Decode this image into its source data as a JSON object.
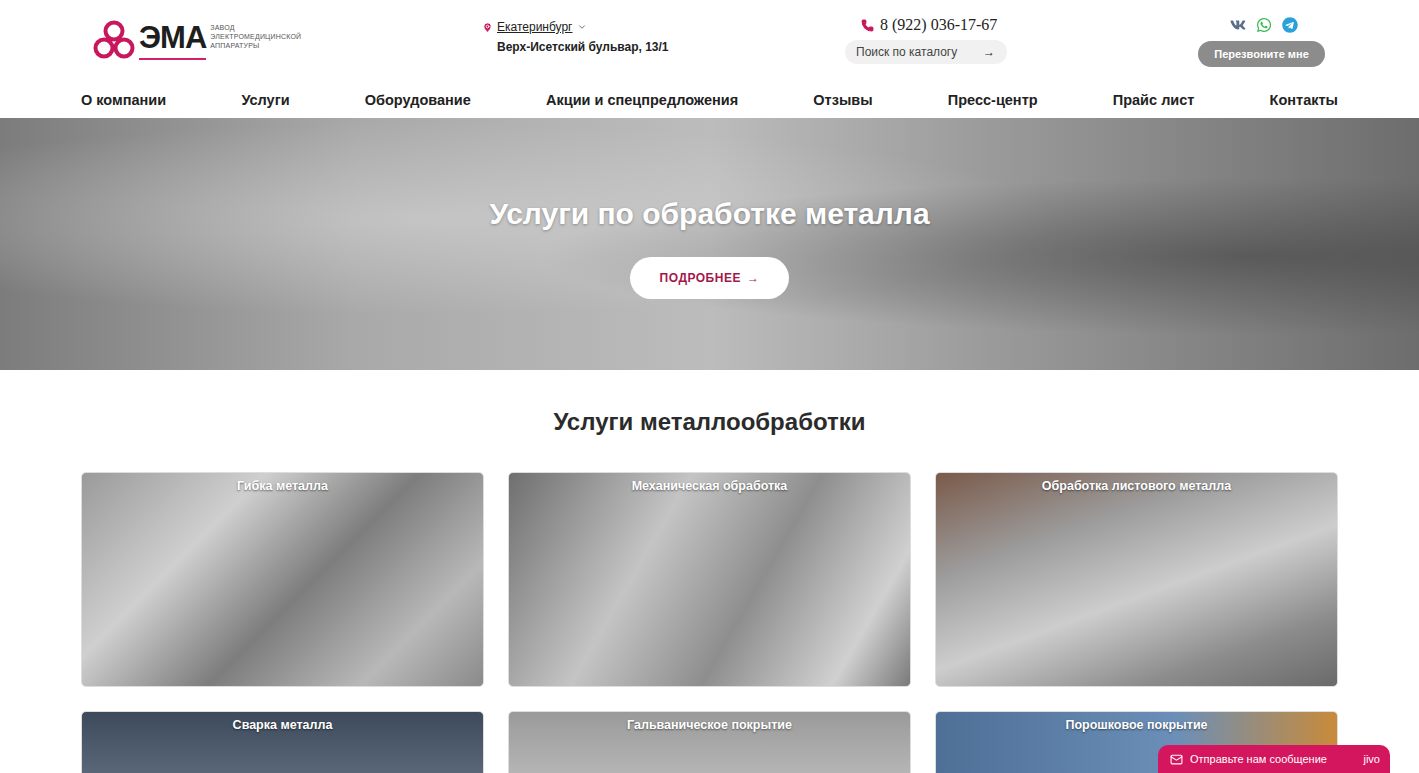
{
  "header": {
    "logo": {
      "mark": "ЭМА",
      "subtitle": [
        "ЗАВОД",
        "ЭЛЕКТРОМЕДИЦИНСКОЙ",
        "АППАРАТУРЫ"
      ]
    },
    "location": {
      "city": "Екатеринбург",
      "address": "Верх-Исетский бульвар, 13/1"
    },
    "phone": "8 (922) 036-17-67",
    "search": {
      "placeholder": "Поиск по каталогу",
      "button": "→"
    },
    "callback_button": "Перезвоните мне"
  },
  "nav": [
    "О компании",
    "Услуги",
    "Оборудование",
    "Акции и спецпредложения",
    "Отзывы",
    "Пресс-центр",
    "Прайс лист",
    "Контакты"
  ],
  "hero": {
    "title": "Услуги по обработке металла",
    "button": "ПОДРОБНЕЕ",
    "button_arrow": "→"
  },
  "section": {
    "title": "Услуги металлообработки"
  },
  "cards": [
    "Гибка металла",
    "Механическая обработка",
    "Обработка листового металла",
    "Сварка металла",
    "Гальваническое покрытие",
    "Порошковое покрытие"
  ],
  "chat_widget": {
    "label": "Отправьте нам сообщение",
    "brand": "jivo"
  }
}
